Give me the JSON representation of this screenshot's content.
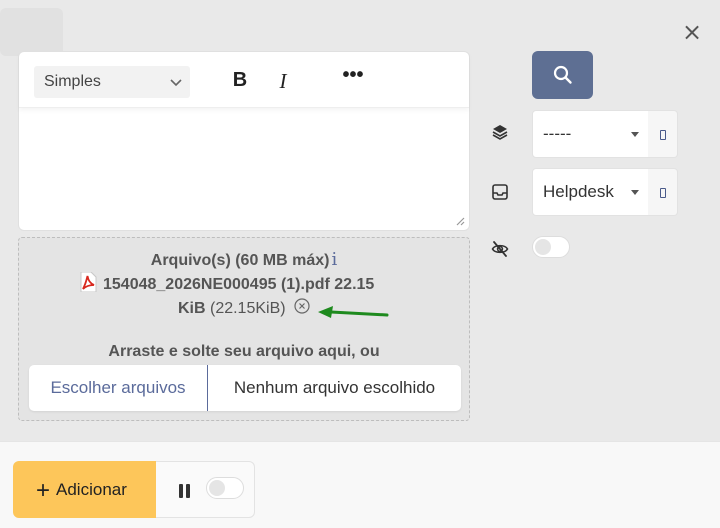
{
  "window": {
    "close_label": "×"
  },
  "editor": {
    "format_select": "Simples",
    "bold_label": "B",
    "italic_label": "I",
    "more_label": "•••"
  },
  "upload": {
    "title": "Arquivo(s) (60 MB máx)",
    "info_label": "i",
    "file_name": "154048_2026NE000495 (1).pdf 22.15",
    "file_size_unit": "KiB",
    "file_size_detail": "(22.15KiB)",
    "drop_hint": "Arraste e solte seu arquivo aqui, ou",
    "choose_button": "Escolher arquivos",
    "no_file_label": "Nenhum arquivo escolhido"
  },
  "sidebar": {
    "layer_select": "-----",
    "inbox_select": "Helpdesk"
  },
  "footer": {
    "add_label": "Adicionar",
    "add_icon": "+"
  },
  "colors": {
    "accent_blue": "#5e6f93",
    "add_yellow": "#fdc65a",
    "arrow_green": "#1e8a1e"
  }
}
